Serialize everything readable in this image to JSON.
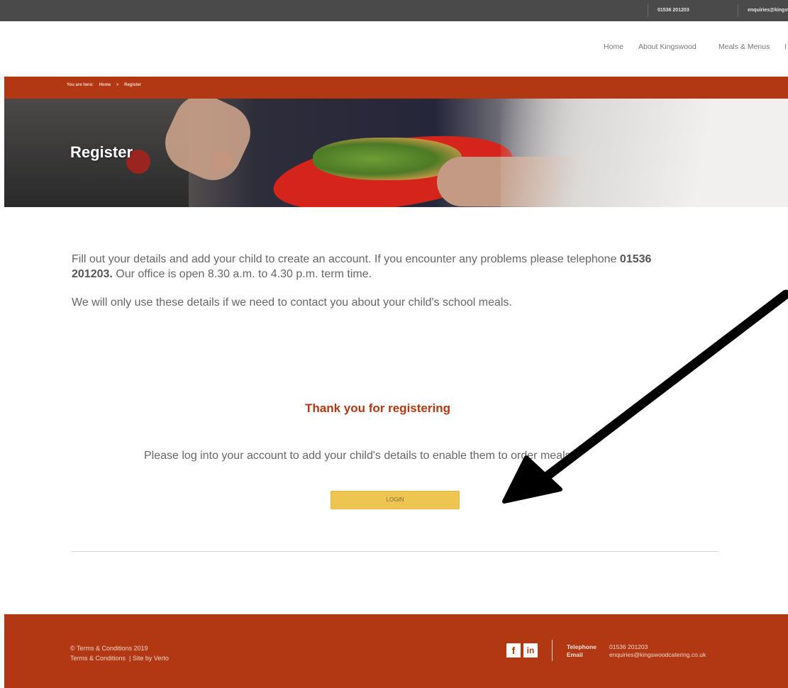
{
  "topbar": {
    "phone": "01536 201203",
    "email": "enquiries@kingswood"
  },
  "nav": {
    "items": [
      "Home",
      "About Kingswood",
      "Meals & Menus",
      "I"
    ]
  },
  "breadcrumb": {
    "prefix": "You are here:",
    "home": "Home",
    "separator": ">",
    "current": "Register"
  },
  "hero": {
    "title": "Register"
  },
  "intro": {
    "line1_a": "Fill out your details and add your child to create an account. If you encounter any problems please telephone ",
    "phone": "01536 201203.",
    "line1_b": " Our office is open 8.30 a.m. to 4.30 p.m. term time.",
    "line2": "We will only use these details if we need to contact you about your child's school meals."
  },
  "confirmation": {
    "title": "Thank you for registering",
    "message": "Please log into your account to add your child's details to enable them to order meals.",
    "login_label": "LOGIN"
  },
  "footer": {
    "copyright": "© Terms & Conditions 2019",
    "terms_link": "Terms & Conditions",
    "link_separator": "|",
    "site_by": "Site by Verto",
    "social": [
      "f",
      "in"
    ],
    "telephone_label": "Telephone",
    "telephone_value": "01536 201203",
    "email_label": "Email",
    "email_value": "enquiries@kingswoodcatering.co.uk"
  },
  "colors": {
    "brand": "#b13812",
    "button": "#eec550",
    "topbar": "#4a4a4a"
  }
}
